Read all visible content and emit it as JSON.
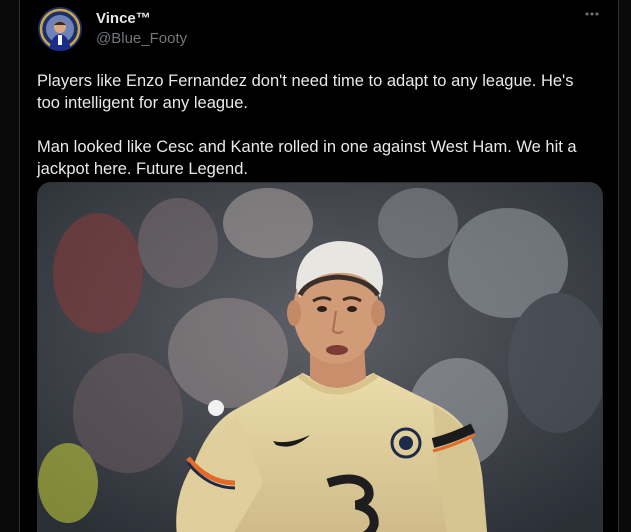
{
  "tweet": {
    "author_name": "Vince™",
    "author_handle": "@Blue_Footy",
    "more_icon": "ellipsis-icon",
    "paragraphs": [
      "Players like Enzo Fernandez don't need time to adapt to any league. He's too intelligent for any league.",
      "Man looked like Cesc and Kante rolled in one against West Ham. We hit a jackpot here. Future Legend."
    ],
    "media_description_icon": "photo-player-image"
  },
  "colors": {
    "background": "#000000",
    "text": "#e7e9ea",
    "secondary_text": "#71767b",
    "border": "#2f3336",
    "kit": "#e3cf9b",
    "sleeve_band": "#e36a2b"
  }
}
